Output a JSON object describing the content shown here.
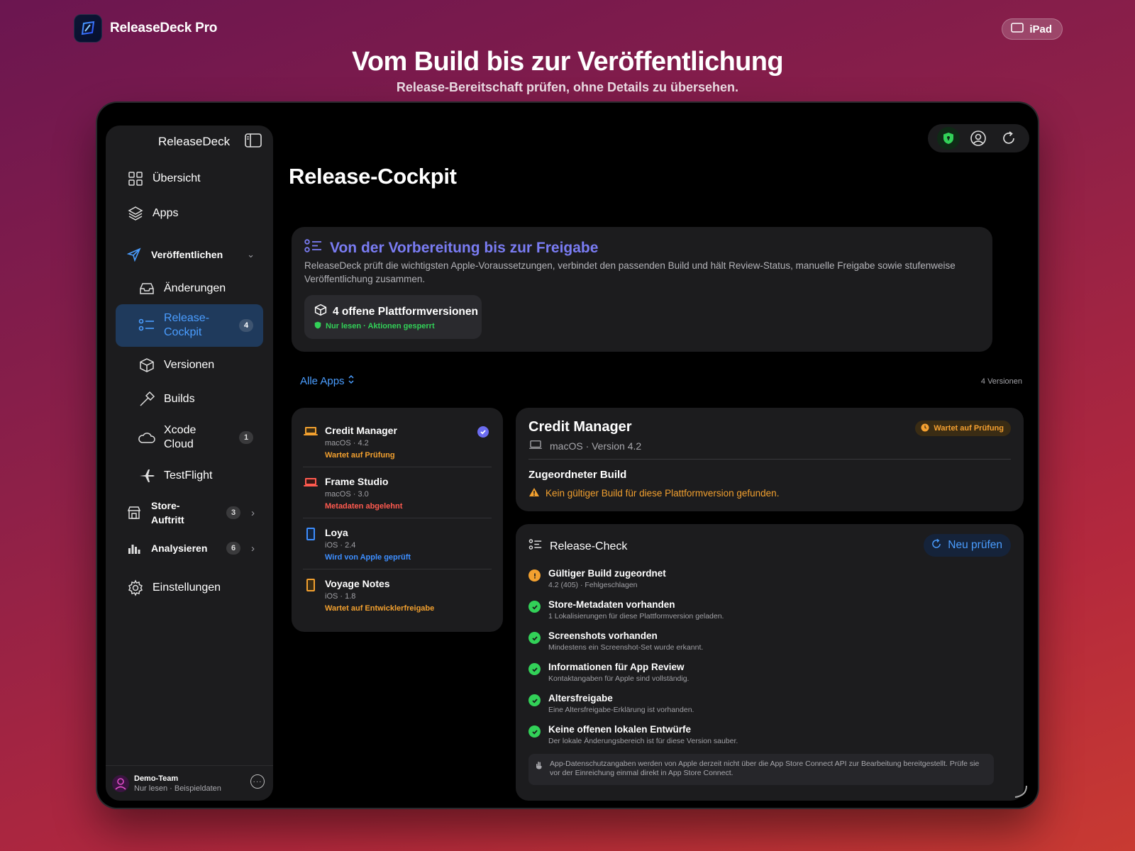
{
  "brand": {
    "name": "ReleaseDeck Pro"
  },
  "device_pill": {
    "label": "iPad",
    "icon": "ipad-icon"
  },
  "marketing": {
    "headline": "Vom Build bis zur Veröffentlichung",
    "subline": "Release-Bereitschaft prüfen, ohne Details zu übersehen."
  },
  "sidebar": {
    "title": "ReleaseDeck",
    "items": [
      {
        "label": "Übersicht",
        "icon": "grid-icon"
      },
      {
        "label": "Apps",
        "icon": "layers-icon"
      },
      {
        "label": "Veröffentlichen",
        "icon": "paperplane-icon"
      },
      {
        "label": "Änderungen",
        "icon": "tray-icon"
      },
      {
        "label": "Release-\nCockpit",
        "icon": "checklist-icon",
        "badge": "4"
      },
      {
        "label": "Versionen",
        "icon": "cube-icon"
      },
      {
        "label": "Builds",
        "icon": "hammer-icon"
      },
      {
        "label": "Xcode\nCloud",
        "icon": "cloud-icon",
        "badge": "1"
      },
      {
        "label": "TestFlight",
        "icon": "airplane-icon"
      },
      {
        "label": "Store-\nAuftritt",
        "icon": "storefront-icon",
        "badge": "3"
      },
      {
        "label": "Analysieren",
        "icon": "chart-icon",
        "badge": "6"
      },
      {
        "label": "Einstellungen",
        "icon": "gear-icon"
      }
    ],
    "footer": {
      "team": "Demo-Team",
      "mode": "Nur lesen · Beispieldaten"
    }
  },
  "page": {
    "title": "Release-Cockpit"
  },
  "hero": {
    "title": "Von der Vorbereitung bis zur Freigabe",
    "description": "ReleaseDeck prüft die wichtigsten Apple-Voraussetzungen, verbindet den passenden Build und hält Review-Status, manuelle Freigabe sowie stufenweise Veröffentlichung zusammen.",
    "box_title": "4 offene Plattformversionen",
    "box_status": "Nur lesen · Aktionen gesperrt"
  },
  "filter": {
    "label": "Alle Apps",
    "count": "4 Versionen"
  },
  "apps": [
    {
      "name": "Credit Manager",
      "meta": "macOS · 4.2",
      "status": "Wartet auf Prüfung",
      "status_color": "#f2a02f",
      "icon": "laptop-icon",
      "selected": true
    },
    {
      "name": "Frame Studio",
      "meta": "macOS · 3.0",
      "status": "Metadaten abgelehnt",
      "status_color": "#ff5a4f",
      "icon": "laptop-icon"
    },
    {
      "name": "Loya",
      "meta": "iOS · 2.4",
      "status": "Wird von Apple geprüft",
      "status_color": "#3d8eff",
      "icon": "phone-icon"
    },
    {
      "name": "Voyage Notes",
      "meta": "iOS · 1.8",
      "status": "Wartet auf Entwicklerfreigabe",
      "status_color": "#f2a02f",
      "icon": "phone-icon"
    }
  ],
  "detail": {
    "name": "Credit Manager",
    "meta": "macOS · Version 4.2",
    "badge": "Wartet auf Prüfung",
    "section": "Zugeordneter Build",
    "warning": "Kein gültiger Build für diese Plattformversion gefunden."
  },
  "release_check": {
    "title": "Release-Check",
    "recheck_label": "Neu prüfen",
    "items": [
      {
        "title": "Gültiger Build zugeordnet",
        "detail": "4.2 (405) · Fehlgeschlagen",
        "state": "warning"
      },
      {
        "title": "Store-Metadaten vorhanden",
        "detail": "1 Lokalisierungen für diese Plattformversion geladen.",
        "state": "ok"
      },
      {
        "title": "Screenshots vorhanden",
        "detail": "Mindestens ein Screenshot-Set wurde erkannt.",
        "state": "ok"
      },
      {
        "title": "Informationen für App Review",
        "detail": "Kontaktangaben für Apple sind vollständig.",
        "state": "ok"
      },
      {
        "title": "Altersfreigabe",
        "detail": "Eine Altersfreigabe-Erklärung ist vorhanden.",
        "state": "ok"
      },
      {
        "title": "Keine offenen lokalen Entwürfe",
        "detail": "Der lokale Änderungsbereich ist für diese Version sauber.",
        "state": "ok"
      }
    ],
    "note": "App-Datenschutzangaben werden von Apple derzeit nicht über die App Store Connect API zur Bearbeitung bereitgestellt. Prüfe sie vor der Einreichung einmal direkt in App Store Connect."
  },
  "colors": {
    "accent_blue": "#4a9dff",
    "accent_indigo": "#7a7cf3",
    "ok_green": "#32d158",
    "warn_orange": "#f2a02f",
    "error_red": "#ff5a4f"
  }
}
